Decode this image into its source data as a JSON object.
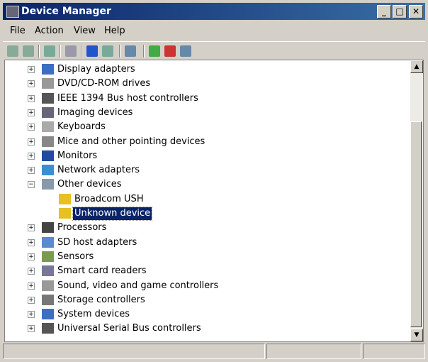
{
  "window": {
    "title": "Device Manager",
    "minimize": "_",
    "maximize": "□",
    "close": "✕"
  },
  "menu": [
    "File",
    "Action",
    "View",
    "Help"
  ],
  "toolbar": [
    "back-icon",
    "forward-icon",
    "show-hide-console-tree-icon",
    "properties-icon",
    "help-icon",
    "action-pane-icon",
    "scan-hardware-icon",
    "update-driver-icon",
    "uninstall-icon",
    "disable-icon"
  ],
  "tree": [
    {
      "label": "Display adapters",
      "color": "#3a6fc4"
    },
    {
      "label": "DVD/CD-ROM drives",
      "color": "#999"
    },
    {
      "label": "IEEE 1394 Bus host controllers",
      "color": "#555"
    },
    {
      "label": "Imaging devices",
      "color": "#667"
    },
    {
      "label": "Keyboards",
      "color": "#aaa"
    },
    {
      "label": "Mice and other pointing devices",
      "color": "#888"
    },
    {
      "label": "Monitors",
      "color": "#224aa0"
    },
    {
      "label": "Network adapters",
      "color": "#3a8fd4"
    },
    {
      "label": "Other devices",
      "color": "#8899aa",
      "expanded": true,
      "children": [
        {
          "label": "Broadcom USH",
          "color": "#e8c020"
        },
        {
          "label": "Unknown device",
          "color": "#e8c020",
          "selected": true
        }
      ]
    },
    {
      "label": "Processors",
      "color": "#444"
    },
    {
      "label": "SD host adapters",
      "color": "#5a8ad0"
    },
    {
      "label": "Sensors",
      "color": "#7a9a50"
    },
    {
      "label": "Smart card readers",
      "color": "#779"
    },
    {
      "label": "Sound, video and game controllers",
      "color": "#999"
    },
    {
      "label": "Storage controllers",
      "color": "#777"
    },
    {
      "label": "System devices",
      "color": "#3a6fc4"
    },
    {
      "label": "Universal Serial Bus controllers",
      "color": "#555"
    }
  ],
  "scroll": {
    "up": "▲",
    "down": "▼"
  }
}
